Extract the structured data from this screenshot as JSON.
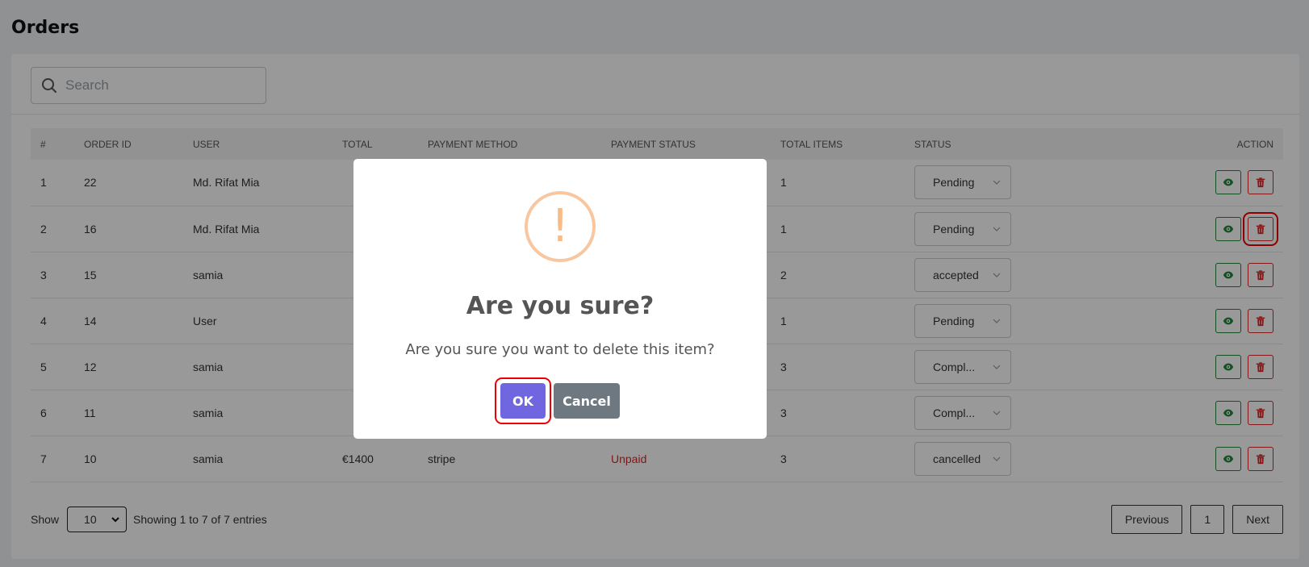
{
  "page": {
    "title": "Orders"
  },
  "search": {
    "placeholder": "Search",
    "icon": "search-icon"
  },
  "table": {
    "columns": [
      "#",
      "ORDER ID",
      "USER",
      "TOTAL",
      "PAYMENT METHOD",
      "PAYMENT STATUS",
      "TOTAL ITEMS",
      "STATUS",
      "ACTION"
    ],
    "rows": [
      {
        "num": "1",
        "order_id": "22",
        "user": "Md. Rifat Mia",
        "total": "",
        "payment_method": "",
        "payment_status": "",
        "total_items": "1",
        "status": "Pending"
      },
      {
        "num": "2",
        "order_id": "16",
        "user": "Md. Rifat Mia",
        "total": "",
        "payment_method": "",
        "payment_status": "",
        "total_items": "1",
        "status": "Pending"
      },
      {
        "num": "3",
        "order_id": "15",
        "user": "samia",
        "total": "",
        "payment_method": "",
        "payment_status": "",
        "total_items": "2",
        "status": "accepted"
      },
      {
        "num": "4",
        "order_id": "14",
        "user": "User",
        "total": "",
        "payment_method": "",
        "payment_status": "",
        "total_items": "1",
        "status": "Pending"
      },
      {
        "num": "5",
        "order_id": "12",
        "user": "samia",
        "total": "",
        "payment_method": "",
        "payment_status": "",
        "total_items": "3",
        "status": "Compl..."
      },
      {
        "num": "6",
        "order_id": "11",
        "user": "samia",
        "total": "",
        "payment_method": "",
        "payment_status": "",
        "total_items": "3",
        "status": "Compl..."
      },
      {
        "num": "7",
        "order_id": "10",
        "user": "samia",
        "total": "€1400",
        "payment_method": "stripe",
        "payment_status": "Unpaid",
        "total_items": "3",
        "status": "cancelled"
      }
    ]
  },
  "footer": {
    "show_label": "Show",
    "page_size": "10",
    "entries_text": "Showing 1 to 7 of 7 entries",
    "prev_label": "Previous",
    "current_page": "1",
    "next_label": "Next"
  },
  "modal": {
    "title": "Are you sure?",
    "text": "Are you sure you want to delete this item?",
    "ok_label": "OK",
    "cancel_label": "Cancel",
    "icon_glyph": "!"
  },
  "colors": {
    "ok": "#7066e0",
    "cancel": "#6e7881",
    "view": "#22863a",
    "delete": "#dc2626",
    "warning": "#f8bb86"
  }
}
